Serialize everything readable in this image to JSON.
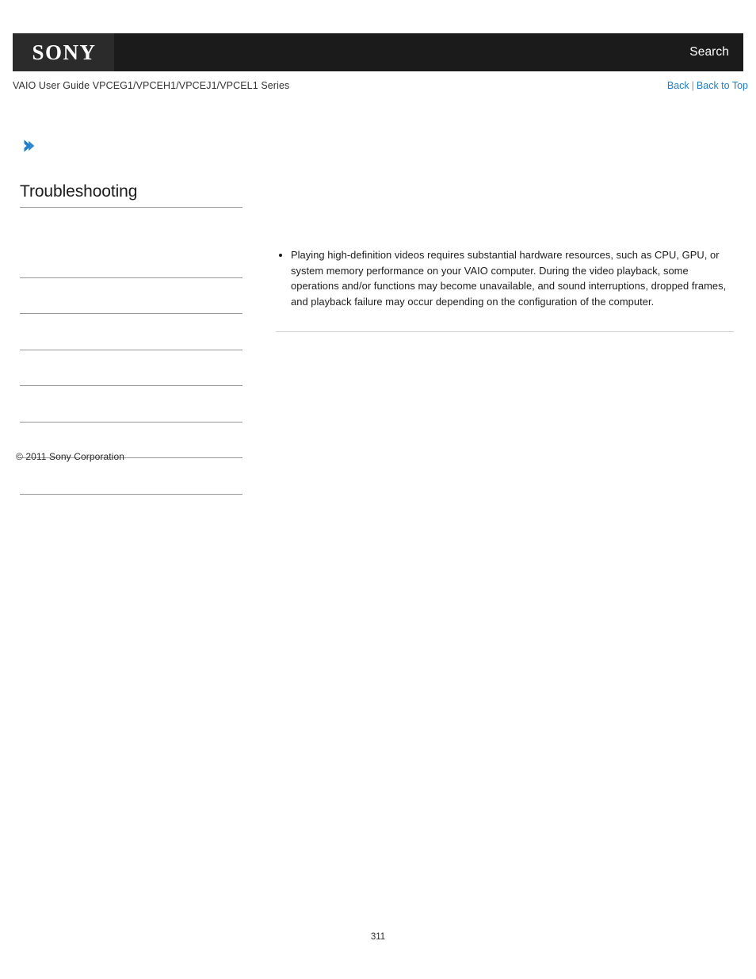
{
  "header": {
    "logo_text": "SONY",
    "search_label": "Search",
    "bar_color": "#1b1b1b",
    "logo_block_color": "#2b2b2b"
  },
  "utility": {
    "guide_title": "VAIO User Guide VPCEG1/VPCEH1/VPCEJ1/VPCEL1 Series",
    "back_label": "Back",
    "separator": "|",
    "back_to_top_label": "Back to Top",
    "link_color": "#1d7fd0"
  },
  "icons": {
    "chevron": "chevron-right-icon",
    "chevron_color": "#1d7fd0"
  },
  "heading": {
    "title": "Troubleshooting"
  },
  "sidebar": {
    "items": [
      {
        "label": ""
      },
      {
        "label": ""
      },
      {
        "label": ""
      },
      {
        "label": ""
      },
      {
        "label": ""
      },
      {
        "label": ""
      },
      {
        "label": ""
      }
    ]
  },
  "main": {
    "bullets": [
      "Playing high-definition videos requires substantial hardware resources, such as CPU, GPU, or system memory performance on your VAIO computer. During the video playback, some operations and/or functions may become unavailable, and sound interruptions, dropped frames, and playback failure may occur depending on the configuration of the computer."
    ]
  },
  "footer": {
    "copyright": "© 2011 Sony Corporation",
    "page_number": "311"
  }
}
